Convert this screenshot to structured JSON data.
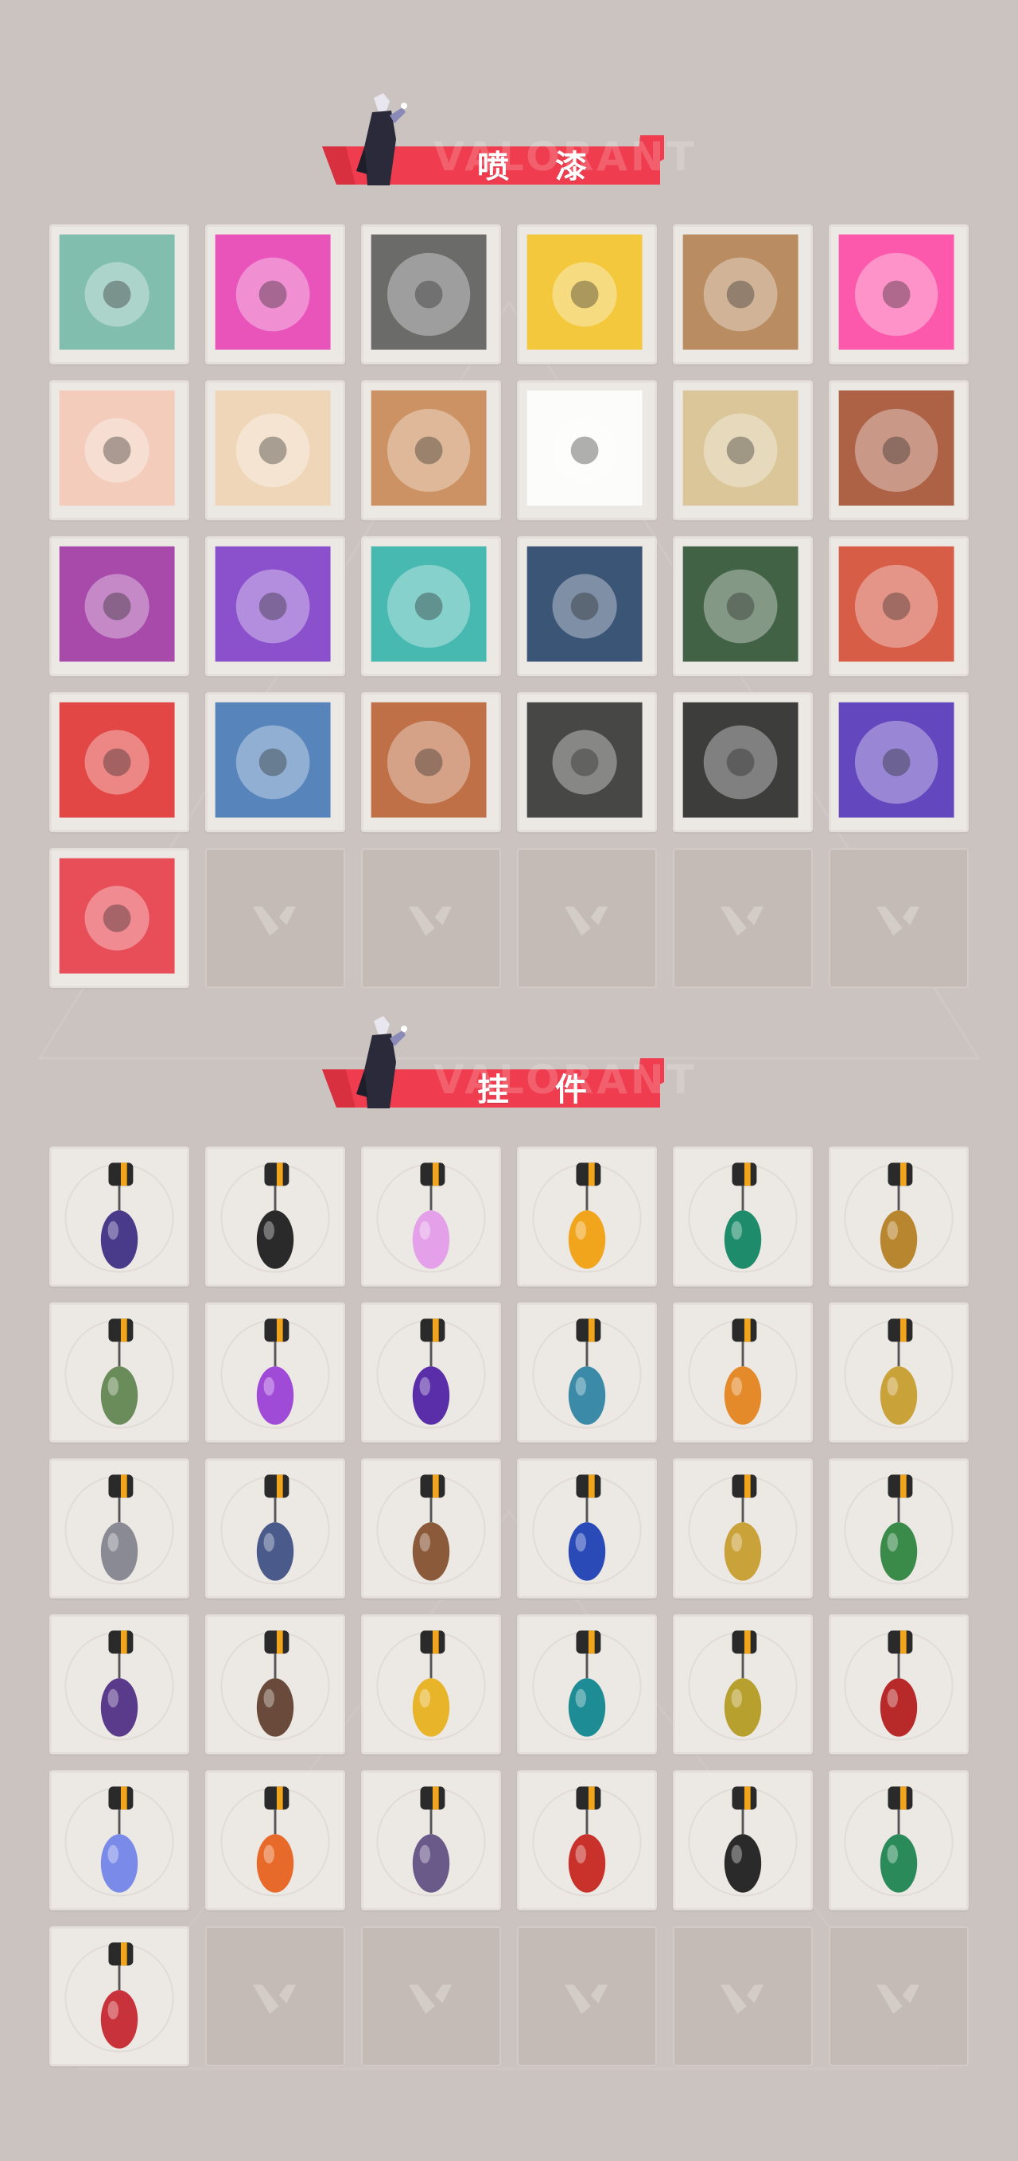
{
  "sections": [
    {
      "id": "sprays",
      "title": "喷 漆",
      "watermark": "VALORANT",
      "items": [
        {
          "icon": "woman-with-green-orb-spray-icon",
          "color": "#6fb6a4"
        },
        {
          "icon": "pink-blue-shark-dragon-spray-icon",
          "color": "#e93ab4"
        },
        {
          "icon": "black-white-manta-spray-icon",
          "color": "#555555"
        },
        {
          "icon": "green-beanie-girl-spray-icon",
          "color": "#f4c21f"
        },
        {
          "icon": "bear-with-sunglasses-spray-icon",
          "color": "#b07b4a"
        },
        {
          "icon": "neon-pink-heart-spray-icon",
          "color": "#ff3fa2"
        },
        {
          "icon": "surprised-white-hair-face-spray-icon",
          "color": "#f5c7b4"
        },
        {
          "icon": "man-with-glasses-spray-icon",
          "color": "#f1d2b0"
        },
        {
          "icon": "laughing-character-spray-icon",
          "color": "#c8824c"
        },
        {
          "icon": "white-ghost-spray-icon",
          "color": "#ffffff"
        },
        {
          "icon": "robot-hat-spray-icon",
          "color": "#d7c08c"
        },
        {
          "icon": "red-fox-mask-spray-icon",
          "color": "#a24a2a"
        },
        {
          "icon": "grinning-purple-face-spray-icon",
          "color": "#9b2ea0"
        },
        {
          "icon": "purple-peace-hand-spray-icon",
          "color": "#7a36c8"
        },
        {
          "icon": "teal-spiral-pattern-spray-icon",
          "color": "#2ab0a8"
        },
        {
          "icon": "masked-agent-face-spray-icon",
          "color": "#1c3b64"
        },
        {
          "icon": "peeking-bear-spray-icon",
          "color": "#254a2a"
        },
        {
          "icon": "mustache-king-spray-icon",
          "color": "#d4442c"
        },
        {
          "icon": "red-card-referee-spray-icon",
          "color": "#e02a2a"
        },
        {
          "icon": "swirl-glasses-man-spray-icon",
          "color": "#3c72b4"
        },
        {
          "icon": "shouting-bearded-man-spray-icon",
          "color": "#b75a2c"
        },
        {
          "icon": "hooded-eyes-spray-icon",
          "color": "#2a2a2a"
        },
        {
          "icon": "valorant-logo-splash-spray-icon",
          "color": "#1e1e1e"
        },
        {
          "icon": "purple-graffiti-text-spray-icon",
          "color": "#4b2ab8"
        },
        {
          "icon": "red-circle-valorant-logo-spray-icon",
          "color": "#e8323f"
        }
      ]
    },
    {
      "id": "buddies",
      "title": "挂 件",
      "watermark": "VALORANT",
      "items": [
        {
          "icon": "ep9-medallion-buddy-icon",
          "color": "#4a3a8a"
        },
        {
          "icon": "black-dragon-buddy-icon",
          "color": "#2a2a2a"
        },
        {
          "icon": "lava-lamp-buddy-icon",
          "color": "#e4a0e8"
        },
        {
          "icon": "golden-crystal-buddy-icon",
          "color": "#f1a51c"
        },
        {
          "icon": "ep8-green-medallion-buddy-icon",
          "color": "#1e8c6a"
        },
        {
          "icon": "pretzel-buddy-icon",
          "color": "#b8862e"
        },
        {
          "icon": "bottle-buddy-icon",
          "color": "#6a8c5a"
        },
        {
          "icon": "purple-flame-lotus-buddy-icon",
          "color": "#a04ad8"
        },
        {
          "icon": "ep8-purple-medallion-buddy-icon",
          "color": "#5a2ea8"
        },
        {
          "icon": "ufo-buddy-icon",
          "color": "#3a8aa8"
        },
        {
          "icon": "orange-cat-buddy-icon",
          "color": "#e48a2a"
        },
        {
          "icon": "frying-pan-egg-buddy-icon",
          "color": "#c9a23a"
        },
        {
          "icon": "gray-cat-buddy-icon",
          "color": "#8a8a94"
        },
        {
          "icon": "sneaker-buddy-icon",
          "color": "#4a5a8a"
        },
        {
          "icon": "target-box-buddy-icon",
          "color": "#8a5a3a"
        },
        {
          "icon": "ep8-blue-medallion-buddy-icon",
          "color": "#2a4ab8"
        },
        {
          "icon": "gold-treble-clef-buddy-icon",
          "color": "#c9a23a"
        },
        {
          "icon": "campfire-lantern-buddy-icon",
          "color": "#3a8a4a"
        },
        {
          "icon": "knife-candy-buddy-icon",
          "color": "#5a3a8a"
        },
        {
          "icon": "tribal-mask-buddy-icon",
          "color": "#6a4a3a"
        },
        {
          "icon": "bee-bird-buddy-icon",
          "color": "#e8b42a"
        },
        {
          "icon": "teal-treble-clef-buddy-icon",
          "color": "#1e8c94"
        },
        {
          "icon": "golden-dagger-buddy-icon",
          "color": "#b8a02e"
        },
        {
          "icon": "red-drum-buddy-icon",
          "color": "#b82a2a"
        },
        {
          "icon": "snowflake-buddy-icon",
          "color": "#7a8ae8"
        },
        {
          "icon": "ep7-orange-medallion-buddy-icon",
          "color": "#e86a2a"
        },
        {
          "icon": "tassel-buddy-icon",
          "color": "#6a5a8a"
        },
        {
          "icon": "ep7-red-medallion-buddy-icon",
          "color": "#c8322a"
        },
        {
          "icon": "valorant-v-medallion-buddy-icon",
          "color": "#2a2a2a"
        },
        {
          "icon": "ep8-green-shield-buddy-icon",
          "color": "#2a8a5a"
        },
        {
          "icon": "red-diamond-logo-buddy-icon",
          "color": "#c8323a"
        }
      ]
    }
  ],
  "accent_color": "#ef3d4f",
  "background_color": "#cbc3bf"
}
